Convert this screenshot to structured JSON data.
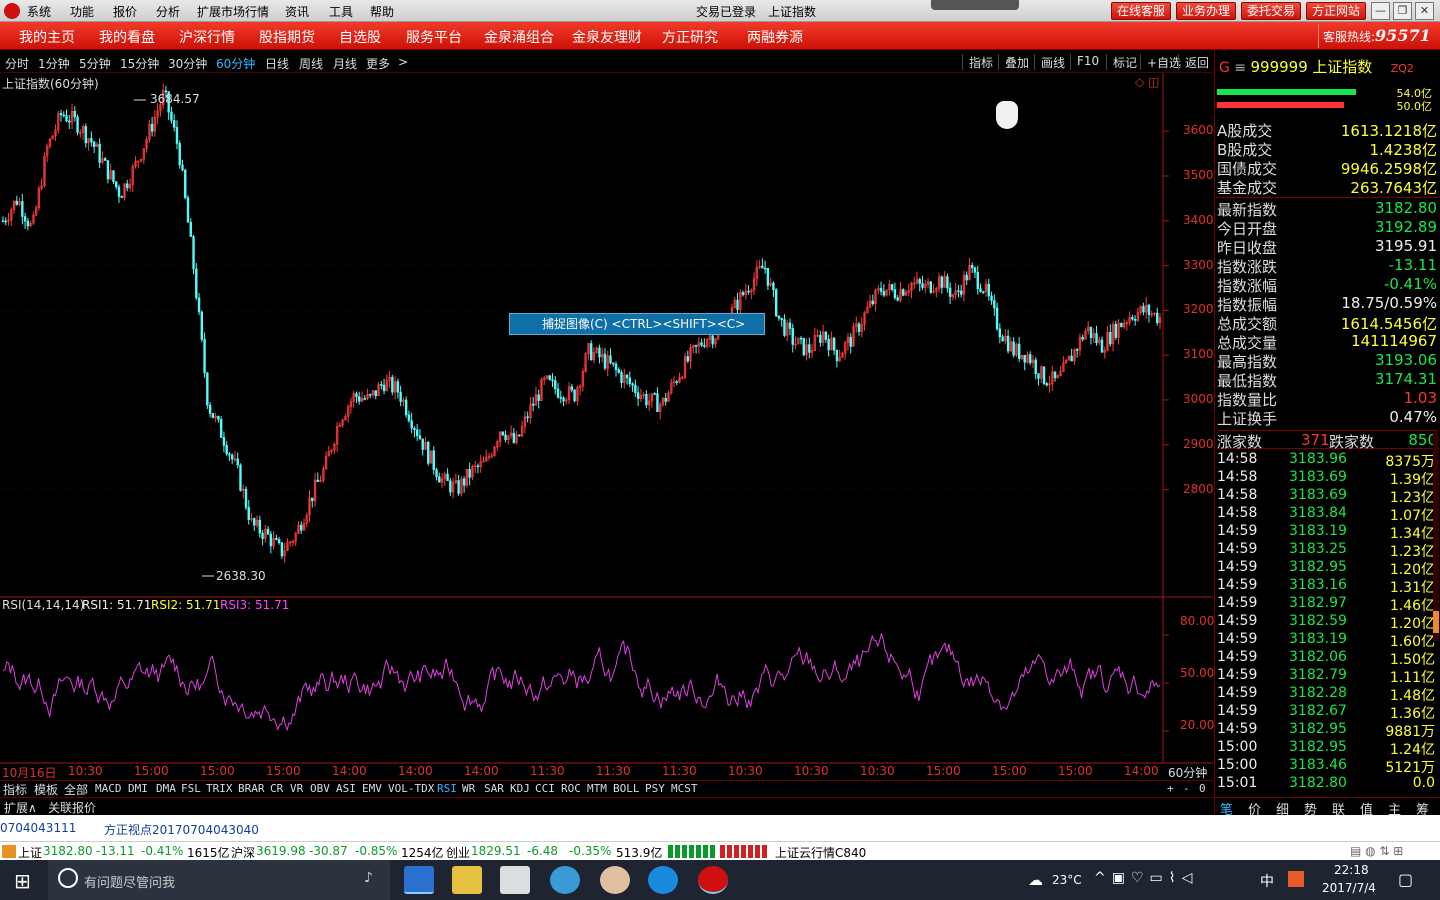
{
  "titlebar": {
    "menus": [
      "系统",
      "功能",
      "报价",
      "分析",
      "扩展市场行情",
      "资讯",
      "工具",
      "帮助"
    ],
    "status": "交易已登录",
    "index_name": "上证指数",
    "buttons": [
      "在线客服",
      "业务办理",
      "委托交易",
      "方正网站"
    ]
  },
  "nav": {
    "items": [
      "我的主页",
      "我的看盘",
      "沪深行情",
      "股指期货",
      "自选股",
      "服务平台",
      "金泉涌组合",
      "金泉友理财",
      "方正研究",
      "两融券源"
    ],
    "hotline_label": "客服热线:",
    "hotline_number": "95571"
  },
  "periods": {
    "items": [
      "分时",
      "1分钟",
      "5分钟",
      "15分钟",
      "30分钟",
      "60分钟",
      "日线",
      "周线",
      "月线",
      "更多"
    ],
    "active": "60分钟",
    "more_arrow": ">"
  },
  "tools": [
    "指标",
    "叠加",
    "画线",
    "F10",
    "标记",
    "+自选",
    "返回"
  ],
  "chart": {
    "label": "上证指数(60分钟)",
    "high_label": "3684.57",
    "low_label": "2638.30",
    "yticks": [
      "3600",
      "3500",
      "3400",
      "3300",
      "3200",
      "3100",
      "3000",
      "2900",
      "2800"
    ],
    "period_tag": "60分钟",
    "xticks": [
      "10月16日",
      "10:30",
      "15:00",
      "15:00",
      "15:00",
      "14:00",
      "14:00",
      "14:00",
      "11:30",
      "11:30",
      "11:30",
      "10:30",
      "10:30",
      "10:30",
      "15:00",
      "15:00",
      "15:00",
      "14:00"
    ]
  },
  "capture_tip": "捕捉图像(C)    <CTRL><SHIFT><C>",
  "indicator": {
    "name": "RSI(14,14,14)",
    "rsi1": "RSI1: 51.71",
    "rsi2": "RSI2: 51.71",
    "rsi3": "RSI3: 51.71",
    "yticks": [
      "80.00",
      "50.00",
      "20.00"
    ]
  },
  "chart_data": {
    "type": "candlestick",
    "title": "上证指数(60分钟)",
    "ylim": [
      2560,
      3730
    ],
    "annotated_high": 3684.57,
    "annotated_low": 2638.3,
    "approx_close_path": [
      3400,
      3450,
      3380,
      3560,
      3640,
      3620,
      3580,
      3520,
      3460,
      3520,
      3600,
      3684,
      3560,
      3300,
      2990,
      2920,
      2840,
      2720,
      2700,
      2660,
      2700,
      2780,
      2850,
      2960,
      3010,
      3000,
      3040,
      3020,
      2950,
      2880,
      2820,
      2800,
      2840,
      2860,
      2940,
      2900,
      2980,
      3040,
      3020,
      3010,
      3110,
      3090,
      3060,
      3030,
      3000,
      2990,
      3050,
      3100,
      3140,
      3150,
      3210,
      3260,
      3300,
      3180,
      3130,
      3110,
      3150,
      3100,
      3140,
      3200,
      3250,
      3240,
      3260,
      3250,
      3270,
      3230,
      3290,
      3250,
      3160,
      3110,
      3100,
      3050,
      3040,
      3100,
      3160,
      3120,
      3160,
      3190,
      3200,
      3183
    ]
  },
  "indicator_tabs": {
    "items": [
      "指标",
      "模板",
      "全部",
      "MACD",
      "DMI",
      "DMA",
      "FSL",
      "TRIX",
      "BRAR",
      "CR",
      "VR",
      "OBV",
      "ASI",
      "EMV",
      "VOL-TDX",
      "RSI",
      "WR",
      "SAR",
      "KDJ",
      "CCI",
      "ROC",
      "MTM",
      "BOLL",
      "PSY",
      "MCST"
    ],
    "active": "RSI",
    "right": [
      "+",
      "-",
      "0"
    ]
  },
  "ext": {
    "items": [
      "扩展∧",
      "关联报价"
    ]
  },
  "right": {
    "header": {
      "mark": "G",
      "code": "999999",
      "name": "上证指数",
      "tag": "ZQ2"
    },
    "bars": [
      {
        "value": "54.0亿",
        "color": "#19e64d",
        "fraction": 0.73
      },
      {
        "value": "50.0亿",
        "color": "#ff3333",
        "fraction": 0.67
      }
    ],
    "turnover": [
      {
        "k": "A股成交",
        "v": "1613.1218亿"
      },
      {
        "k": "B股成交",
        "v": "1.4238亿"
      },
      {
        "k": "国债成交",
        "v": "9946.2598亿"
      },
      {
        "k": "基金成交",
        "v": "263.7643亿"
      }
    ],
    "stats": [
      {
        "k": "最新指数",
        "v": "3182.80",
        "c": "green"
      },
      {
        "k": "今日开盘",
        "v": "3192.89",
        "c": "green"
      },
      {
        "k": "昨日收盘",
        "v": "3195.91",
        "c": "white"
      },
      {
        "k": "指数涨跌",
        "v": "-13.11",
        "c": "green"
      },
      {
        "k": "指数涨幅",
        "v": "-0.41%",
        "c": "green"
      },
      {
        "k": "指数振幅",
        "v": "18.75/0.59%",
        "c": "white"
      },
      {
        "k": "总成交额",
        "v": "1614.5456亿",
        "c": "yellow"
      },
      {
        "k": "总成交量",
        "v": "141114967",
        "c": "yellow"
      },
      {
        "k": "最高指数",
        "v": "3193.06",
        "c": "green"
      },
      {
        "k": "最低指数",
        "v": "3174.31",
        "c": "green"
      },
      {
        "k": "指数量比",
        "v": "1.03",
        "c": "red"
      },
      {
        "k": "上证换手",
        "v": "0.47%",
        "c": "white"
      }
    ],
    "updown": {
      "up_label": "涨家数",
      "up": "371",
      "down_label": "跌家数",
      "down": "850"
    },
    "ticks": [
      {
        "t": "14:58",
        "p": "3183.96",
        "v": "8375万"
      },
      {
        "t": "14:58",
        "p": "3183.69",
        "v": "1.39亿"
      },
      {
        "t": "14:58",
        "p": "3183.69",
        "v": "1.23亿"
      },
      {
        "t": "14:58",
        "p": "3183.84",
        "v": "1.07亿"
      },
      {
        "t": "14:59",
        "p": "3183.19",
        "v": "1.34亿"
      },
      {
        "t": "14:59",
        "p": "3183.25",
        "v": "1.23亿"
      },
      {
        "t": "14:59",
        "p": "3182.95",
        "v": "1.20亿"
      },
      {
        "t": "14:59",
        "p": "3183.16",
        "v": "1.31亿"
      },
      {
        "t": "14:59",
        "p": "3182.97",
        "v": "1.46亿"
      },
      {
        "t": "14:59",
        "p": "3182.59",
        "v": "1.20亿"
      },
      {
        "t": "14:59",
        "p": "3183.19",
        "v": "1.60亿"
      },
      {
        "t": "14:59",
        "p": "3182.06",
        "v": "1.50亿"
      },
      {
        "t": "14:59",
        "p": "3182.79",
        "v": "1.11亿"
      },
      {
        "t": "14:59",
        "p": "3182.28",
        "v": "1.48亿"
      },
      {
        "t": "14:59",
        "p": "3182.67",
        "v": "1.36亿"
      },
      {
        "t": "14:59",
        "p": "3182.95",
        "v": "9881万"
      },
      {
        "t": "15:00",
        "p": "3182.95",
        "v": "1.24亿"
      },
      {
        "t": "15:00",
        "p": "3183.46",
        "v": "5121万"
      },
      {
        "t": "15:01",
        "p": "3182.80",
        "v": "0.0"
      }
    ],
    "bottom_tabs": [
      "笔",
      "价",
      "细",
      "势",
      "联",
      "值",
      "主",
      "筹"
    ]
  },
  "news": {
    "item1": "0704043111",
    "item2": "方正视点20170704043040"
  },
  "quotes": [
    {
      "name": "上证",
      "price": "3182.80",
      "chg": "-13.11",
      "pct": "-0.41%",
      "vol": "1615亿"
    },
    {
      "name": "沪深",
      "price": "3619.98",
      "chg": "-30.87",
      "pct": "-0.85%",
      "vol": "1254亿"
    },
    {
      "name": "创业",
      "price": "1829.51",
      "chg": "-6.48",
      "pct": "-0.35%",
      "vol": "513.9亿"
    }
  ],
  "quote_extra": "上证云行情C840",
  "taskbar": {
    "search_placeholder": "有问题尽管问我",
    "weather": "23°C",
    "ime": "中",
    "time": "22:18",
    "date": "2017/7/4"
  }
}
